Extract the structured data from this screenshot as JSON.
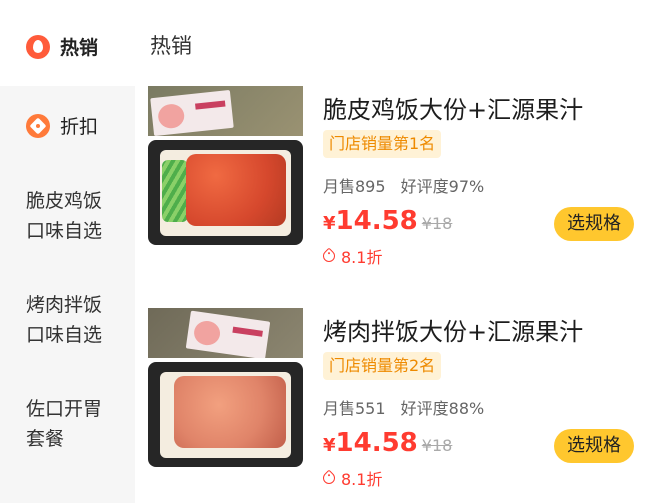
{
  "sidebar": {
    "items": [
      {
        "label": "热销",
        "icon": "fire-icon"
      },
      {
        "label": "折扣",
        "icon": "discount-icon"
      },
      {
        "lines": [
          "脆皮鸡饭",
          "口味自选"
        ]
      },
      {
        "lines": [
          "烤肉拌饭",
          "口味自选"
        ]
      },
      {
        "lines": [
          "佐口开胃",
          "套餐"
        ]
      }
    ]
  },
  "main": {
    "title": "热销"
  },
  "products": [
    {
      "name": "脆皮鸡饭大份+汇源果汁",
      "badge": "门店销量第1名",
      "monthly_sales": "月售895",
      "rating": "好评度97%",
      "currency": "¥",
      "price": "14.58",
      "original_price": "¥18",
      "discount": "8.1折",
      "button": "选规格"
    },
    {
      "name": "烤肉拌饭大份+汇源果汁",
      "badge": "门店销量第2名",
      "monthly_sales": "月售551",
      "rating": "好评度88%",
      "currency": "¥",
      "price": "14.58",
      "original_price": "¥18",
      "discount": "8.1折",
      "button": "选规格"
    }
  ],
  "colors": {
    "accent": "#ff3b30",
    "button": "#ffc72e",
    "badge_bg": "#fff2d6",
    "badge_text": "#ee8a00"
  }
}
